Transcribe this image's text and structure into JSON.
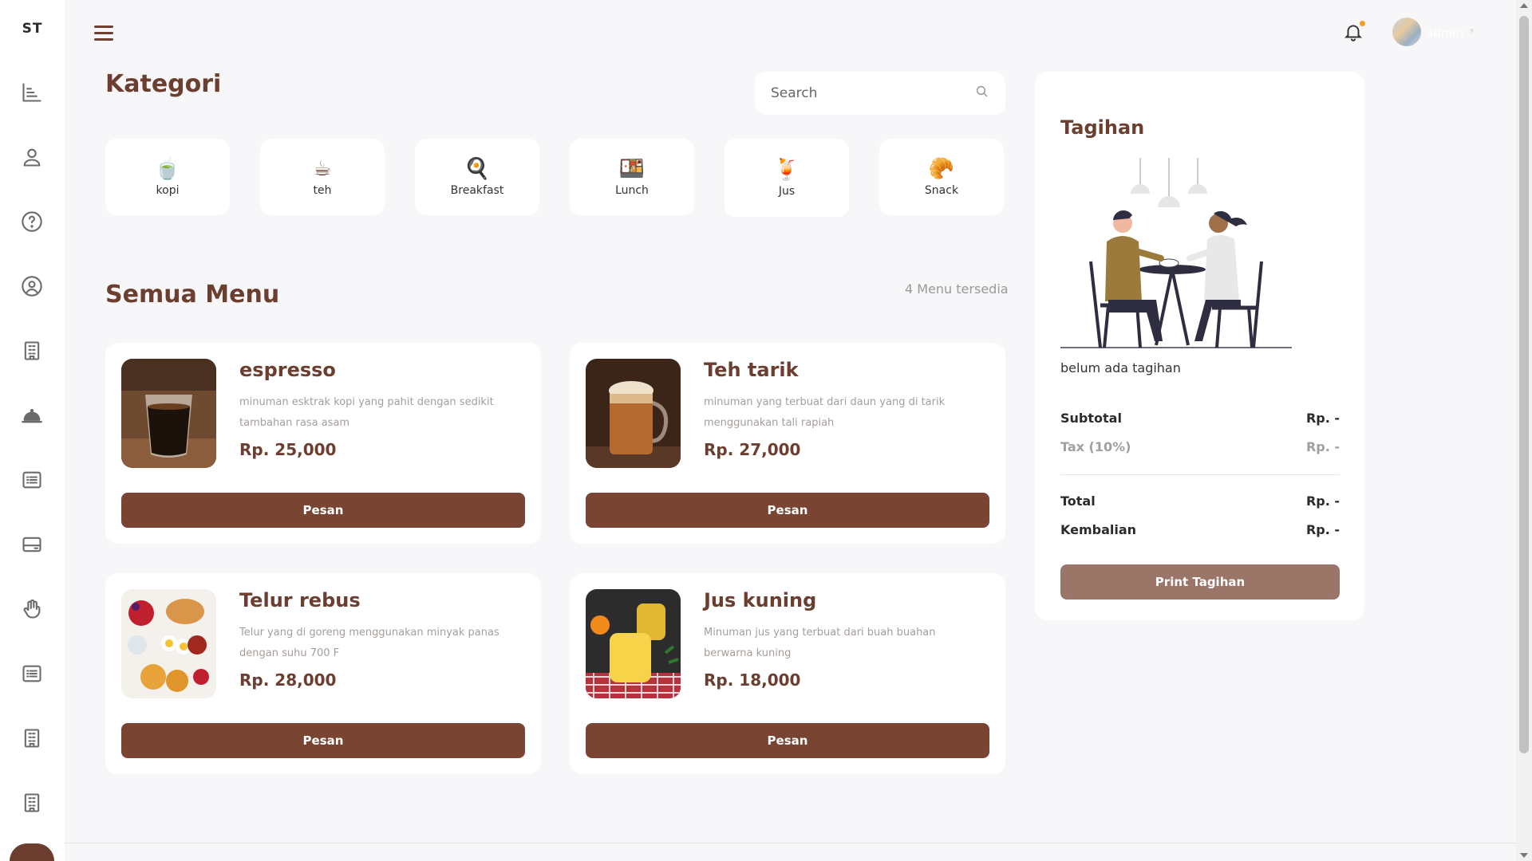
{
  "brand": {
    "logo_text": "ST"
  },
  "sidebar": {
    "icons": [
      "chart-bar-icon",
      "user-icon",
      "help-circle-icon",
      "user-circle-icon",
      "building-icon",
      "service-bell-icon",
      "list-icon",
      "credit-card-icon",
      "hand-icon",
      "list-icon",
      "building-icon",
      "building-icon"
    ]
  },
  "topbar": {
    "username": "admin",
    "has_notification": true
  },
  "kategori": {
    "title": "Kategori",
    "search_placeholder": "Search",
    "items": [
      {
        "label": "kopi",
        "emoji": "🍵"
      },
      {
        "label": "teh",
        "emoji": "☕"
      },
      {
        "label": "Breakfast",
        "emoji": "🍳"
      },
      {
        "label": "Lunch",
        "emoji": "🍱"
      },
      {
        "label": "Jus",
        "emoji": "🍹"
      },
      {
        "label": "Snack",
        "emoji": "🥐"
      }
    ]
  },
  "menu": {
    "title": "Semua Menu",
    "count_label": "4 Menu tersedia",
    "button_label": "Pesan",
    "items": [
      {
        "name": "espresso",
        "desc": "minuman esktrak kopi yang pahit dengan sedikit tambahan rasa asam",
        "price": "Rp. 25,000"
      },
      {
        "name": "Teh tarik",
        "desc": "minuman yang terbuat dari daun yang di tarik menggunakan tali rapiah",
        "price": "Rp. 27,000"
      },
      {
        "name": "Telur rebus",
        "desc": "Telur yang di goreng menggunakan minyak panas dengan suhu 700 F",
        "price": "Rp. 28,000"
      },
      {
        "name": "Jus kuning",
        "desc": "Minuman jus yang terbuat dari buah buahan berwarna kuning",
        "price": "Rp. 18,000"
      }
    ]
  },
  "bill": {
    "title": "Tagihan",
    "empty_text": "belum ada tagihan",
    "subtotal_label": "Subtotal",
    "subtotal_value": "Rp. -",
    "tax_label": "Tax (10%)",
    "tax_value": "Rp. -",
    "total_label": "Total",
    "total_value": "Rp. -",
    "change_label": "Kembalian",
    "change_value": "Rp. -",
    "print_label": "Print Tagihan"
  },
  "colors": {
    "primary": "#7a4433",
    "heading": "#6b3e30",
    "print_button": "#9c7569",
    "background": "#f7f7f9"
  }
}
